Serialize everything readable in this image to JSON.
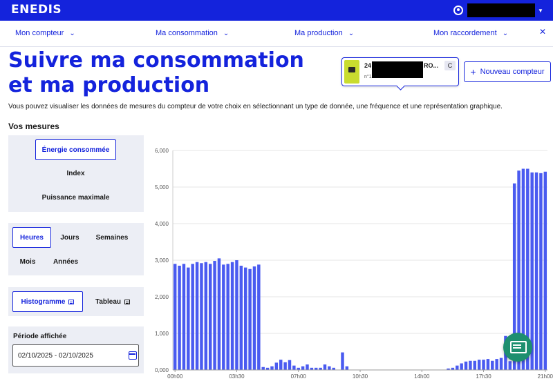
{
  "header": {
    "logo": "ENEDIS",
    "user_name": "",
    "colors": {
      "brand": "#1423dc",
      "chat": "#1d8f6f"
    }
  },
  "nav": {
    "items": [
      {
        "label": "Mon compteur"
      },
      {
        "label": "Ma consommation"
      },
      {
        "label": "Ma production"
      },
      {
        "label": "Mon raccordement"
      }
    ],
    "close_icon": "close-icon"
  },
  "page": {
    "title": "Suivre ma consommation et ma production",
    "intro": "Vous pouvez visualiser les données de mesures du compteur de votre choix en sélectionnant un type de donnée, une fréquence et une représentation graphique.",
    "section_title": "Vos mesures"
  },
  "meter": {
    "id_prefix": "24",
    "name_suffix": "RO...",
    "number_prefix": "n°1",
    "badge": "C"
  },
  "new_meter_button": "Nouveau compteur",
  "data_type": {
    "options": [
      "Énergie consommée",
      "Index",
      "Puissance maximale"
    ],
    "selected": "Énergie consommée"
  },
  "frequency": {
    "options": [
      "Heures",
      "Jours",
      "Semaines",
      "Mois",
      "Années"
    ],
    "selected": "Heures"
  },
  "representation": {
    "options": [
      "Histogramme",
      "Tableau"
    ],
    "selected": "Histogramme"
  },
  "period": {
    "label": "Période affichée",
    "value": "02/10/2025 - 02/10/2025"
  },
  "chart_data": {
    "type": "bar",
    "ylim": [
      0,
      6000
    ],
    "yticks": [
      "0,000",
      "1,000",
      "2,000",
      "3,000",
      "4,000",
      "5,000",
      "6,000"
    ],
    "xticks": [
      "00h00",
      "03h30",
      "07h00",
      "10h30",
      "14h00",
      "17h30",
      "21h00"
    ],
    "color": "#4a5bf0",
    "values": [
      2900,
      2850,
      2900,
      2800,
      2900,
      2950,
      2920,
      2950,
      2900,
      2980,
      3050,
      2880,
      2900,
      2950,
      3000,
      2850,
      2800,
      2760,
      2830,
      2880,
      80,
      60,
      100,
      200,
      280,
      210,
      270,
      120,
      60,
      100,
      150,
      60,
      60,
      60,
      150,
      100,
      60,
      0,
      480,
      100,
      0,
      0,
      0,
      0,
      0,
      0,
      0,
      0,
      0,
      0,
      0,
      0,
      0,
      0,
      0,
      0,
      0,
      0,
      0,
      0,
      0,
      0,
      40,
      60,
      120,
      180,
      230,
      250,
      250,
      280,
      280,
      300,
      250,
      300,
      330,
      930,
      240,
      5100,
      5450,
      5500,
      5500,
      5400,
      5400,
      5380,
      5420
    ]
  }
}
